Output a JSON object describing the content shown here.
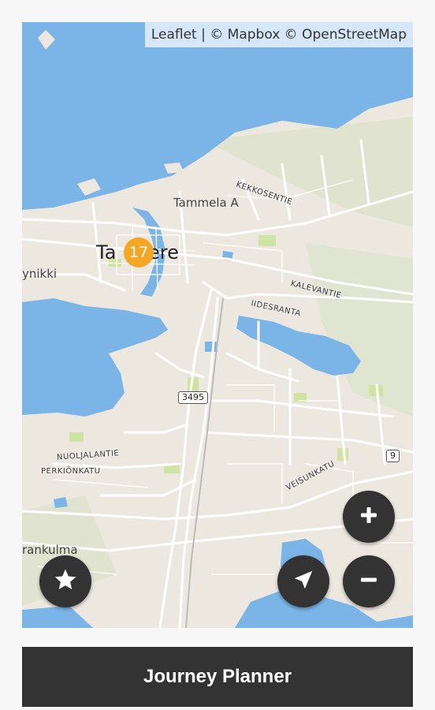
{
  "map": {
    "attribution": "Leaflet | © Mapbox © OpenStreetMap",
    "places": {
      "tammela": "Tammela A",
      "city_left": "Ta",
      "city_right": "ere",
      "ynikki": "ynikki",
      "rankulma": "rankulma"
    },
    "roads": {
      "kekkosentie": "KEKKOSENTIE",
      "kalevantie": "KALEVANTIE",
      "iidesranta": "IIDESRANTA",
      "nuoljalantie": "NUOLJALANTIE",
      "perkionkatu": "PERKIÖNKATU",
      "veisunkatu": "VEISUNKATU"
    },
    "shields": {
      "r3495": "3495",
      "r9": "9"
    },
    "cluster": {
      "count": "17",
      "color": "#f5a623"
    },
    "water_color": "#7bb4e6",
    "land_color": "#ece8e0",
    "park_color": "#cfe3a4"
  },
  "controls": {
    "favorites_icon": "star-icon",
    "locate_icon": "navigation-arrow-icon",
    "zoom_in_icon": "plus-icon",
    "zoom_out_icon": "minus-icon"
  },
  "footer": {
    "journey_planner": "Journey Planner"
  }
}
